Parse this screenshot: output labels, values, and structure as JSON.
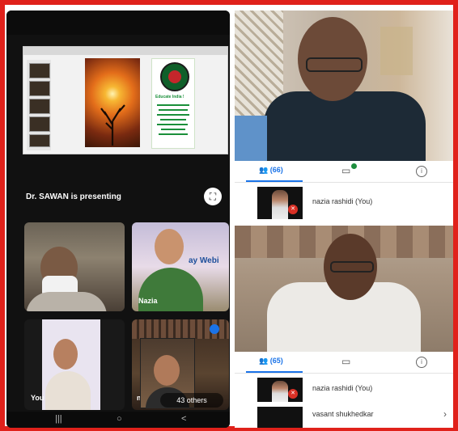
{
  "left_phone": {
    "presenting_label": "Dr. SAWAN is presenting",
    "fullscreen_icon": "fullscreen-icon",
    "slide": {
      "card_title": "Educate India !"
    },
    "tiles": [
      {
        "label": ""
      },
      {
        "label": "Nazia",
        "banner": "ay Webi"
      },
      {
        "label": "You"
      },
      {
        "label": "menke"
      }
    ],
    "others_badge": "43 others",
    "nav": {
      "recents": "|||",
      "home": "○",
      "back": "<"
    }
  },
  "right_phone": {
    "tabs_1": {
      "people_count": "(66)"
    },
    "participant_1": {
      "name": "nazia rashidi (You)"
    },
    "tabs_2": {
      "people_count": "(65)"
    },
    "participant_2": {
      "name": "nazia rashidi (You)"
    },
    "participant_3": {
      "name": "vasant shukhedkar"
    },
    "icons": {
      "people": "people-icon",
      "chat": "chat-icon",
      "info": "info-icon",
      "mic_off": "mic-off-icon",
      "chevron": "chevron-right-icon"
    }
  },
  "colors": {
    "frame": "#e0211b",
    "accent": "#1a73e8",
    "mic_off": "#d93025",
    "chat_badge": "#1e8e3e"
  }
}
